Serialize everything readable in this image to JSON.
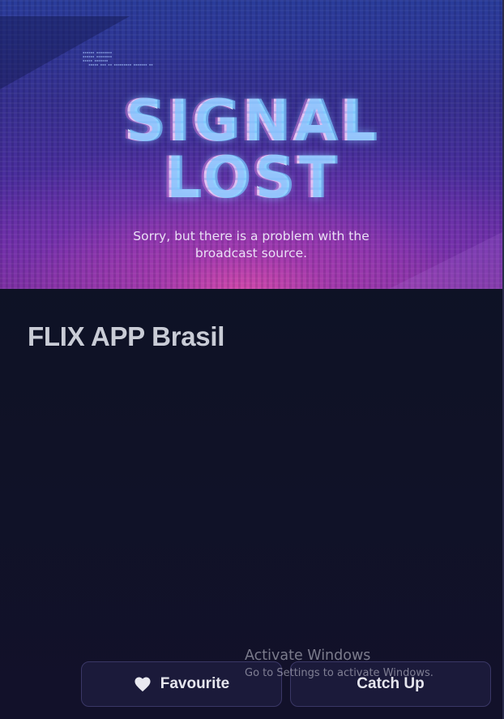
{
  "player": {
    "glitch_line1": "SIGNAL",
    "glitch_line2": "LOST",
    "message_line1": "Sorry, but there is a problem with the",
    "message_line2": "broadcast source."
  },
  "channel": {
    "title": "FLIX APP Brasil"
  },
  "actions": {
    "favourite_label": "Favourite",
    "favourite_icon": "heart-icon",
    "catchup_label": "Catch Up"
  },
  "watermark": {
    "title": "Activate Windows",
    "subtitle": "Go to Settings to activate Windows."
  },
  "colors": {
    "background": "#0f1226",
    "button_bg": "#1b1a3a",
    "button_border": "#3a3766",
    "title_text": "#c9ccd6",
    "accent_magenta": "#d64aaa"
  }
}
